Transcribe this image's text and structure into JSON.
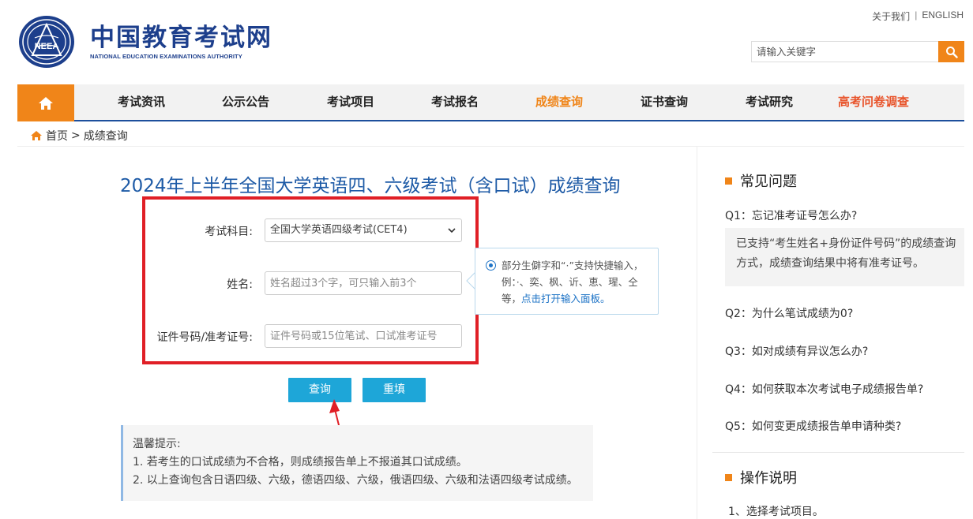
{
  "header": {
    "logo_emblem_text": "NEEA",
    "logo_cn": "中国教育考试网",
    "logo_en": "NATIONAL EDUCATION EXAMINATIONS AUTHORITY",
    "toplinks": {
      "about": "关于我们",
      "sep": "|",
      "english": "ENGLISH"
    },
    "search": {
      "placeholder": "请输入关键字",
      "icon": "search-icon"
    },
    "colors": {
      "brand_blue": "#1d3f8c",
      "accent_orange": "#f08519"
    }
  },
  "nav": {
    "home_icon": "home-icon",
    "items": [
      {
        "label": "考试资讯"
      },
      {
        "label": "公示公告"
      },
      {
        "label": "考试项目"
      },
      {
        "label": "考试报名"
      },
      {
        "label": "成绩查询",
        "active": true
      },
      {
        "label": "证书查询"
      },
      {
        "label": "考试研究"
      },
      {
        "label": "高考问卷调查"
      }
    ]
  },
  "breadcrumb": {
    "home": "首页",
    "sep": ">",
    "current": "成绩查询"
  },
  "main": {
    "title": "2024年上半年全国大学英语四、六级考试（含口试）成绩查询",
    "form": {
      "subject": {
        "label": "考试科目:",
        "value": "全国大学英语四级考试(CET4)"
      },
      "name": {
        "label": "姓名:",
        "placeholder": "姓名超过3个字，可只输入前3个"
      },
      "id": {
        "label": "证件号码/准考证号:",
        "placeholder": "证件号码或15位笔试、口试准考证号"
      }
    },
    "hint": {
      "text": "部分生僻字和“·”支持快捷输入，例：·、奕、枫、䜣、恵、瑆、仝等，",
      "link": "点击打开输入面板。"
    },
    "buttons": {
      "query": "查询",
      "reset": "重填"
    },
    "tips": {
      "title": "温馨提示:",
      "lines": [
        "1. 若考生的口试成绩为不合格，则成绩报告单上不报道其口试成绩。",
        "2. 以上查询包含日语四级、六级，德语四级、六级，俄语四级、六级和法语四级考试成绩。"
      ]
    }
  },
  "sidebar": {
    "faq_title": "常见问题",
    "questions": [
      "Q1：忘记准考证号怎么办?",
      "Q2：为什么笔试成绩为0?",
      "Q3：如对成绩有异议怎么办?",
      "Q4：如何获取本次考试电子成绩报告单?",
      "Q5：如何变更成绩报告单申请种类?"
    ],
    "answer1": "已支持“考生姓名+身份证件号码”的成绩查询方式，成绩查询结果中将有准考证号。",
    "guide_title": "操作说明",
    "steps": [
      "1、选择考试项目。"
    ]
  }
}
